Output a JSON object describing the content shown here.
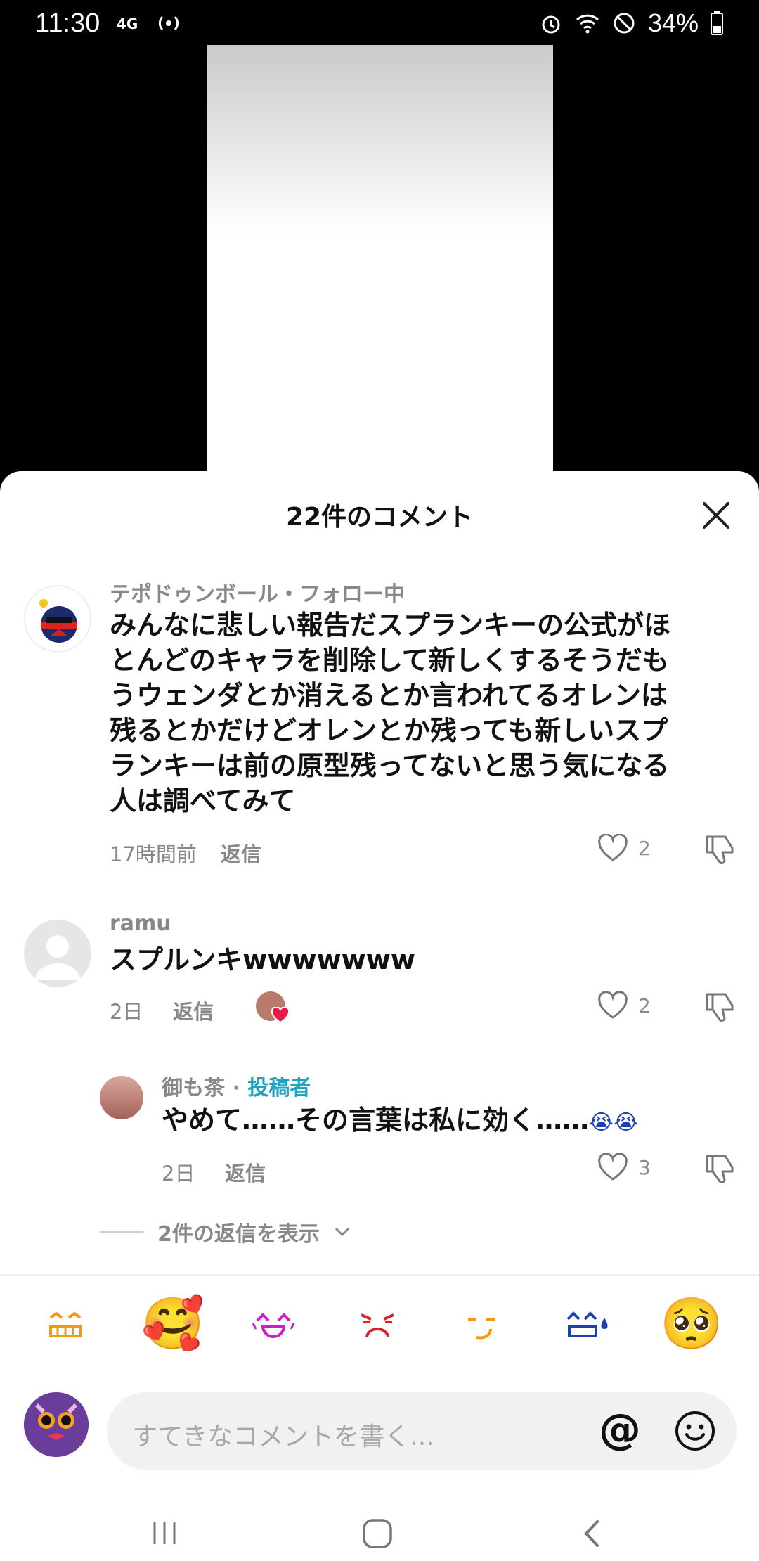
{
  "status_bar": {
    "time": "11:30",
    "battery": "34%",
    "icons": [
      "4g-icon",
      "hotspot-icon",
      "alarm-icon",
      "wifi-icon",
      "do-not-disturb-icon",
      "battery-icon"
    ]
  },
  "comments_sheet": {
    "title": "22件のコメント",
    "comments": [
      {
        "user": "テポドゥンボール・フォロー中",
        "text": "みんなに悲しい報告だスプランキーの公式がほとんどのキャラを削除して新しくするそうだもうウェンダとか消えるとか言われてるオレンは残るとかだけどオレンとか残っても新しいスプランキーは前の原型残ってないと思う気になる人は調べてみて",
        "text_lines": [
          "みんなに悲しい報告だスプランキーの公式がほ",
          "とんどのキャラを削除して新しくするそうだも",
          "うウェンダとか消えるとか言われてるオレンは",
          "残るとかだけどオレンとか残っても新しいスプ",
          "ランキーは前の原型残ってないと思う気になる",
          "人は調べてみて"
        ],
        "time": "17時間前",
        "reply_label": "返信",
        "likes": "2"
      },
      {
        "user": "ramu",
        "text": "スプルンキwwwwwww",
        "time": "2日",
        "reply_label": "返信",
        "likes": "2"
      }
    ],
    "reply": {
      "user": "御も茶",
      "separator": " · ",
      "badge": "投稿者",
      "text": "やめて……その言葉は私に効く……",
      "emoji_suffix": "😭😭",
      "time": "2日",
      "reply_label": "返信",
      "likes": "3"
    },
    "view_replies": "2件の返信を表示"
  },
  "emoji_bar": [
    "grin-emoji",
    "smiling-face-with-hearts-emoji",
    "laughing-emoji",
    "angry-emoji",
    "smirk-emoji",
    "sweat-emoji",
    "pleading-face-emoji"
  ],
  "composer": {
    "placeholder": "すてきなコメントを書く...",
    "at_label": "@"
  },
  "colors": {
    "author_badge": "#1fa4c4",
    "like_heart": "#e6194b"
  }
}
